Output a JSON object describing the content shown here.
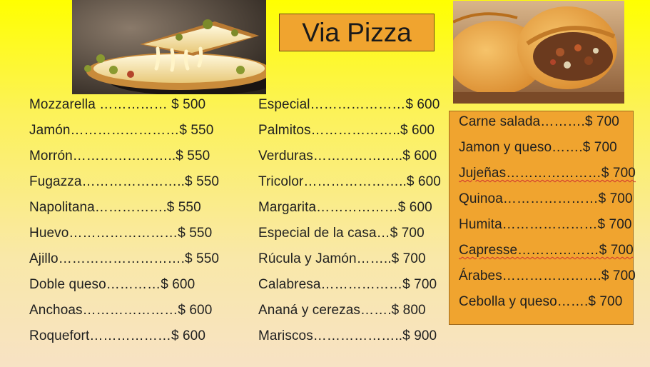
{
  "title": "Via Pizza",
  "menu": {
    "column1": [
      "Mozzarella …………… $ 500",
      "Jamón……………………$ 550",
      "Morrón…………………..$ 550",
      "Fugazza…………………..$ 550",
      "Napolitana…………….$ 550",
      "Huevo……………………$ 550",
      "Ajillo……………………….$ 550",
      "Doble queso…………$ 600",
      "Anchoas…………………$ 600",
      "Roquefort………………$ 600"
    ],
    "column2": [
      "Especial…………………$ 600",
      "Palmitos………………..$ 600",
      "Verduras………………..$ 600",
      "Tricolor…………………..$ 600",
      "Margarita………………$ 600",
      "Especial de la casa…$ 700",
      "Rúcula y Jamón……..$ 700",
      "Calabresa………………$ 700",
      "Ananá y cerezas…….$ 800",
      "Mariscos………………..$ 900"
    ],
    "column3": [
      "Carne salada……….$ 700",
      "Jamon y queso…….$ 700",
      "Jujeñas…………………$ 700",
      "Quinoa…………………$ 700",
      "Humita…………………$ 700",
      "Capresse………………$ 700",
      "Árabes………………….$ 700",
      "Cebolla y queso…….$ 700"
    ]
  },
  "colors": {
    "title_box": "#f0a42f",
    "right_box": "#f0a42f",
    "background_top": "#ffff00",
    "background_bottom": "#f7e2c4"
  }
}
